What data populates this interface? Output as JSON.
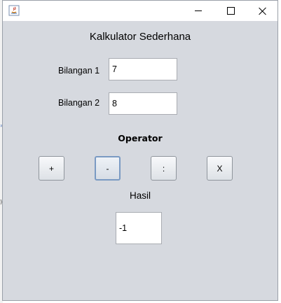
{
  "window": {
    "title": "Kalkulator Sederhana",
    "app_icon": "java-icon"
  },
  "form": {
    "bilangan1_label": "Bilangan 1",
    "bilangan1_value": "7",
    "bilangan2_label": "Bilangan 2",
    "bilangan2_value": "8",
    "operator_heading": "Operator",
    "operators": [
      "+",
      "-",
      ":",
      "X"
    ],
    "hasil_label": "Hasil",
    "hasil_value": "-1"
  },
  "colors": {
    "window_bg": "#d6d9df",
    "focus_border": "#7a9ac3"
  }
}
